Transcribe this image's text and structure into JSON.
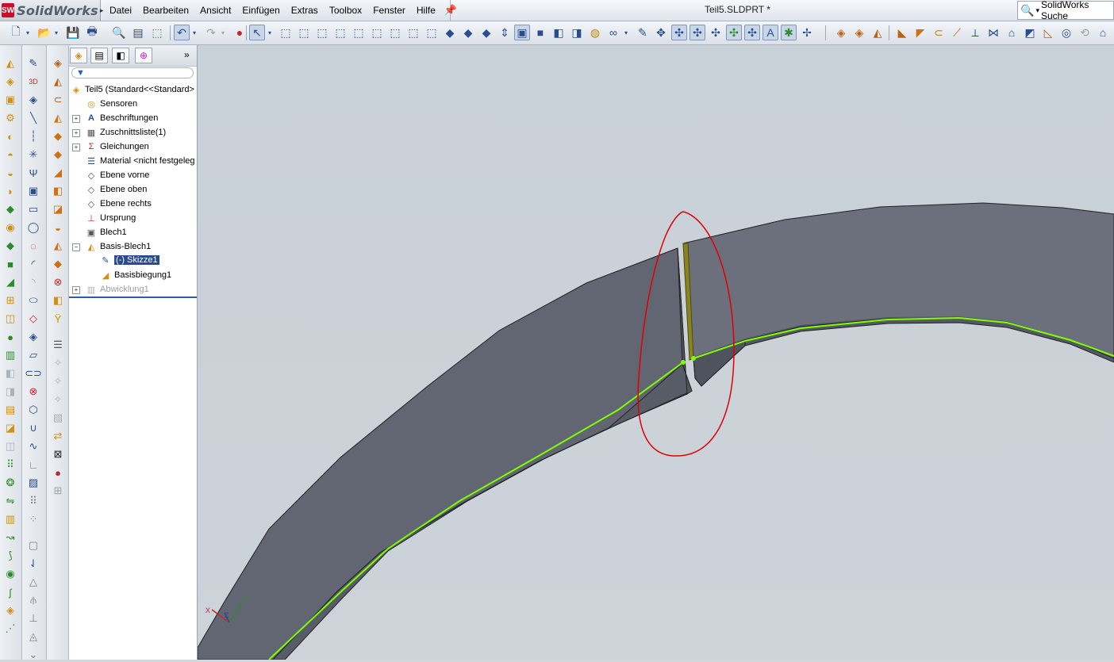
{
  "app": {
    "logo_text": "SolidWorks",
    "logo_mark": "SW",
    "logo_arrow": "▸"
  },
  "menu": {
    "items": [
      "Datei",
      "Bearbeiten",
      "Ansicht",
      "Einfügen",
      "Extras",
      "Toolbox",
      "Fenster",
      "Hilfe"
    ]
  },
  "document": {
    "title": "Teil5.SLDPRT *"
  },
  "search": {
    "label": "SolidWorks Suche",
    "icon": "magnifier-icon"
  },
  "feature_manager": {
    "filter_icon": "filter-icon",
    "tree": [
      {
        "label": "Teil5  (Standard<<Standard>",
        "icon": "part-icon",
        "expander": ""
      },
      {
        "label": "Sensoren",
        "icon": "sensor-icon",
        "expander": ""
      },
      {
        "label": "Beschriftungen",
        "icon": "annotation-icon",
        "expander": "+"
      },
      {
        "label": "Zuschnittsliste(1)",
        "icon": "cutlist-icon",
        "expander": "+"
      },
      {
        "label": "Gleichungen",
        "icon": "equation-icon",
        "expander": "+"
      },
      {
        "label": "Material <nicht festgeleg",
        "icon": "material-icon",
        "expander": ""
      },
      {
        "label": "Ebene vorne",
        "icon": "plane-icon",
        "expander": ""
      },
      {
        "label": "Ebene oben",
        "icon": "plane-icon",
        "expander": ""
      },
      {
        "label": "Ebene rechts",
        "icon": "plane-icon",
        "expander": ""
      },
      {
        "label": "Ursprung",
        "icon": "origin-icon",
        "expander": ""
      },
      {
        "label": "Blech1",
        "icon": "sheetmetal-icon",
        "expander": ""
      },
      {
        "label": "Basis-Blech1",
        "icon": "base-flange-icon",
        "expander": "−"
      },
      {
        "label": "(-) Skizze1",
        "icon": "sketch-icon",
        "expander": ""
      },
      {
        "label": "Basisbiegung1",
        "icon": "bend-icon",
        "expander": ""
      },
      {
        "label": "Abwicklung1",
        "icon": "flatten-icon",
        "expander": "+"
      }
    ]
  },
  "triad": {
    "x": "X",
    "y": "Y",
    "z": "Z"
  },
  "colors": {
    "accent": "#2a4b8d",
    "sketch_line": "#7fff00",
    "highlight_ring": "#e00000",
    "model_face": "#6c707c"
  }
}
